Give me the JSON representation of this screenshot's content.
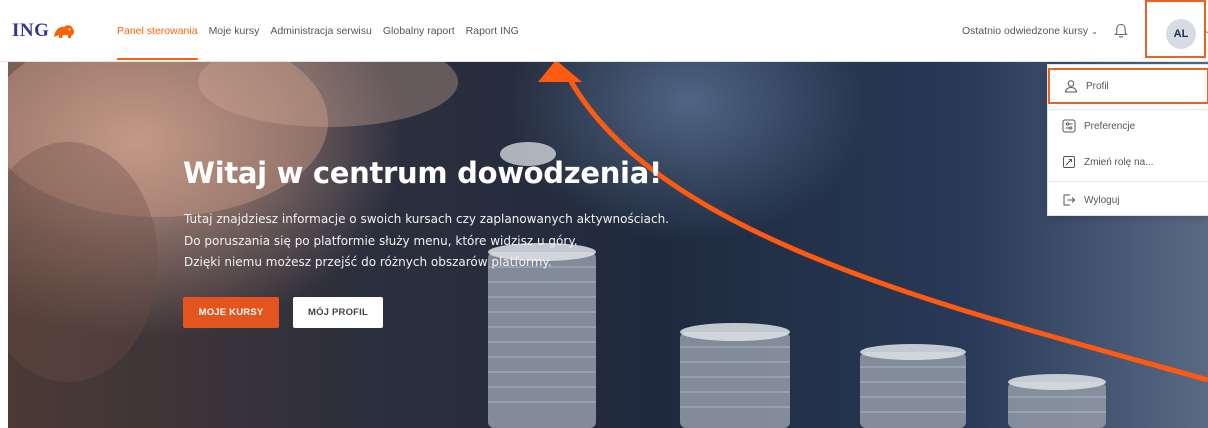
{
  "brand": {
    "logo_text": "ING",
    "accent": "#ff6200"
  },
  "nav": {
    "links": [
      {
        "label": "Panel sterowania",
        "active": true
      },
      {
        "label": "Moje kursy",
        "active": false
      },
      {
        "label": "Administracja serwisu",
        "active": false
      },
      {
        "label": "Globalny raport",
        "active": false
      },
      {
        "label": "Raport ING",
        "active": false
      }
    ],
    "recent_courses": "Ostatnio odwiedzone kursy",
    "bell_icon": "bell-icon",
    "avatar_initials": "AL"
  },
  "hero": {
    "title": "Witaj w centrum dowodzenia!",
    "lines": [
      "Tutaj znajdziesz informacje o swoich kursach czy zaplanowanych aktywnościach.",
      "Do poruszania się po platformie służy menu, które widzisz u góry.",
      "Dzięki niemu możesz przejść do różnych obszarów platformy."
    ],
    "primary_button": "MOJE KURSY",
    "secondary_button": "MÓJ PROFIL"
  },
  "user_menu": {
    "items": [
      {
        "label": "Profil",
        "icon": "user-icon"
      },
      {
        "label": "Preferencje",
        "icon": "preferences-icon"
      },
      {
        "label": "Zmień rolę na...",
        "icon": "switch-role-icon"
      },
      {
        "label": "Wyloguj",
        "icon": "logout-icon"
      }
    ]
  },
  "colors": {
    "primary_button": "#e4541e",
    "highlight": "#e8632a",
    "logo": "#333399"
  }
}
